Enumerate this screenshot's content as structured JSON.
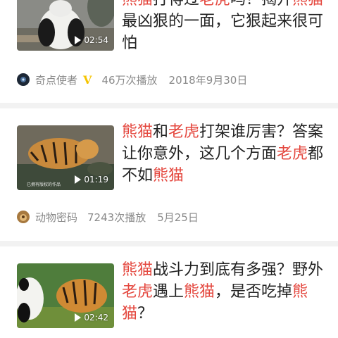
{
  "feed": [
    {
      "title_segments": [
        {
          "text": "熊猫",
          "hl": true
        },
        {
          "text": "打得过",
          "hl": false
        },
        {
          "text": "老虎",
          "hl": true
        },
        {
          "text": "吗？揭开",
          "hl": false
        },
        {
          "text": "熊猫",
          "hl": true
        },
        {
          "text": "最凶狠的一面，它狠起来很可怕",
          "hl": false
        }
      ],
      "duration": "02:54",
      "author": "奇点使者",
      "verified_badge": "V",
      "plays": "46万次播放",
      "date": "2018年9月30日"
    },
    {
      "title_segments": [
        {
          "text": "熊猫",
          "hl": true
        },
        {
          "text": "和",
          "hl": false
        },
        {
          "text": "老虎",
          "hl": true
        },
        {
          "text": "打架谁厉害？答案让你意外，这几个方面",
          "hl": false
        },
        {
          "text": "老虎",
          "hl": true
        },
        {
          "text": "都不如",
          "hl": false
        },
        {
          "text": "熊猫",
          "hl": true
        }
      ],
      "duration": "01:19",
      "watermark": "已拥有版权的作品",
      "author": "动物密码",
      "plays": "7243次播放",
      "date": "5月25日"
    },
    {
      "title_segments": [
        {
          "text": "熊猫",
          "hl": true
        },
        {
          "text": "战斗力到底有多强？野外",
          "hl": false
        },
        {
          "text": "老虎",
          "hl": true
        },
        {
          "text": "遇上",
          "hl": false
        },
        {
          "text": "熊猫",
          "hl": true
        },
        {
          "text": "，是否吃掉",
          "hl": false
        },
        {
          "text": "熊猫",
          "hl": true
        },
        {
          "text": "？",
          "hl": false
        }
      ],
      "duration": "02:42"
    }
  ],
  "colors": {
    "highlight": "#e4473e",
    "meta_text": "#8a8a8a",
    "separator": "#f2f2f2",
    "verified": "#f5c400"
  },
  "icons": [
    "play-icon",
    "avatar"
  ]
}
